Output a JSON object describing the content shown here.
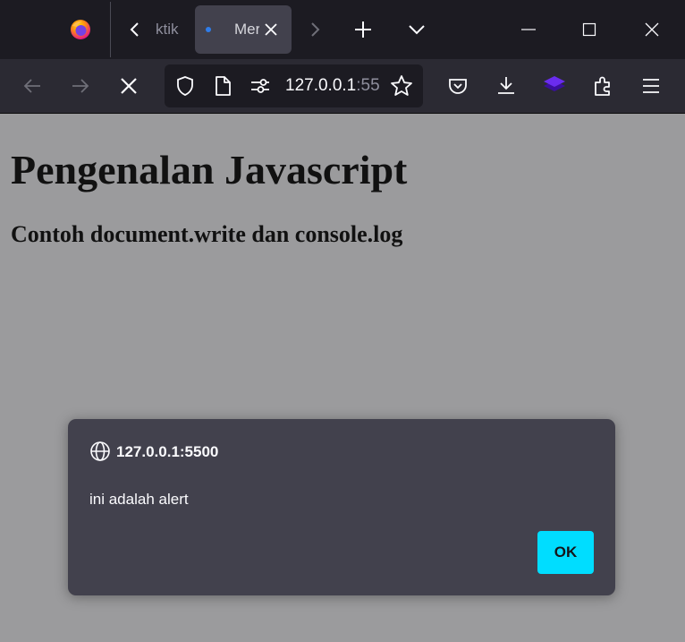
{
  "browser": {
    "tabs": [
      {
        "title": "ktik",
        "active": false
      },
      {
        "title": "Mer",
        "active": true,
        "loading": true
      }
    ],
    "icons": {
      "logo": "firefox-logo",
      "tab_scroll_left": "chevron-left-icon",
      "tab_close": "close-icon",
      "tab_scroll_right": "chevron-right-icon",
      "new_tab": "plus-icon",
      "list_all_tabs": "chevron-down-icon",
      "minimize": "minimize-icon",
      "maximize": "maximize-icon",
      "close_window": "close-icon"
    }
  },
  "toolbar": {
    "url_host": "127.0.0.1",
    "url_rest": ":55",
    "icons": {
      "back": "arrow-left-icon",
      "forward": "arrow-right-icon",
      "stop": "stop-icon",
      "tracking": "shield-icon",
      "page_info": "page-icon",
      "permissions": "permissions-icon",
      "bookmark": "star-icon",
      "pocket": "pocket-icon",
      "downloads": "download-icon",
      "extension": "layers-icon",
      "extensions": "puzzle-icon",
      "menu": "hamburger-icon"
    }
  },
  "page": {
    "heading": "Pengenalan Javascript",
    "subheading": "Contoh document.write dan console.log"
  },
  "dialog": {
    "origin": "127.0.0.1:5500",
    "message": "ini adalah alert",
    "ok_label": "OK"
  },
  "colors": {
    "chrome_dark": "#1c1b22",
    "toolbar": "#2b2a33",
    "active_tab": "#42414d",
    "page_dimmed": "#9b9b9d",
    "dialog_bg": "#42414d",
    "ok_button": "#00ddff",
    "loading_dot": "#2f7dea"
  }
}
